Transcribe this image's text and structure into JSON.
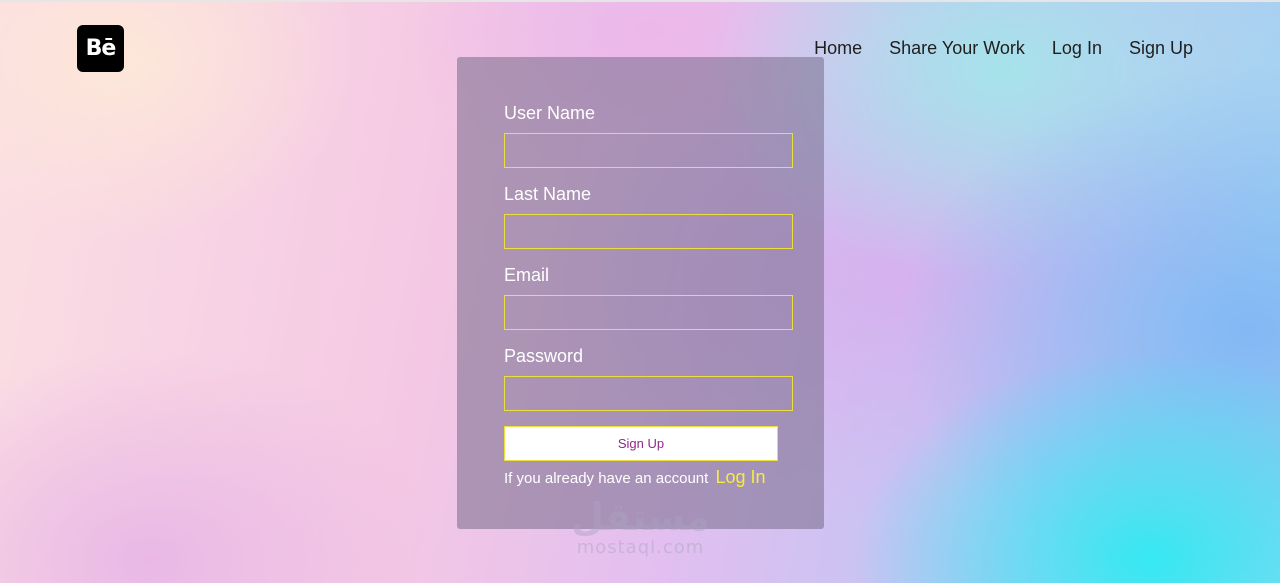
{
  "brand": {
    "logo_text": "Bē",
    "logo_icon": "behance-logo-icon"
  },
  "nav": {
    "items": [
      {
        "label": "Home"
      },
      {
        "label": "Share Your Work"
      },
      {
        "label": "Log In"
      },
      {
        "label": "Sign Up"
      }
    ]
  },
  "form": {
    "fields": [
      {
        "label": "User Name",
        "value": ""
      },
      {
        "label": "Last Name",
        "value": ""
      },
      {
        "label": "Email",
        "value": ""
      },
      {
        "label": "Password",
        "value": ""
      }
    ],
    "submit_label": "Sign Up",
    "account_text": "If you already have an account",
    "login_link": "Log In"
  },
  "watermark": {
    "arabic": "مستقل",
    "latin": "mostaql.com"
  },
  "colors": {
    "field_border": "#ecdf3c",
    "link": "#f6ec3f",
    "button_text": "#8f2a84",
    "card_bg": "rgba(118,108,138,0.55)"
  }
}
